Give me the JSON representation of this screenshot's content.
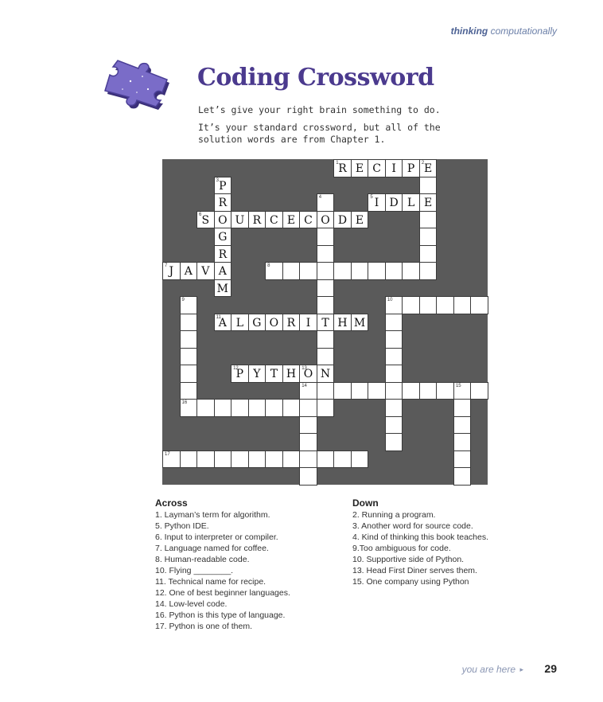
{
  "header": {
    "section_strong": "thinking",
    "section_rest": "computationally"
  },
  "title": "Coding Crossword",
  "intro": {
    "line1": "Let’s give your right brain something to do.",
    "line2": "It’s your standard crossword, but all of the",
    "line3": "solution words are from Chapter 1."
  },
  "across_heading": "Across",
  "down_heading": "Down",
  "across_clues": [
    "1. Layman’s term for algorithm.",
    "5. Python IDE.",
    "6. Input to interpreter or compiler.",
    "7. Language named for coffee.",
    "8. Human-readable code.",
    "10. Flying ________.",
    "11. Technical name for recipe.",
    "12. One of best beginner languages.",
    "14. Low-level code.",
    "16. Python is this type of language.",
    "17. Python is one of them."
  ],
  "down_clues": [
    "2. Running a program.",
    "3. Another word for source code.",
    "4. Kind of thinking this book teaches.",
    "9.Too ambiguous for code.",
    "10. Supportive side of Python.",
    "13. Head First Diner serves them.",
    "15. One company using Python"
  ],
  "footer": {
    "you_are_here": "you are here",
    "page": "29"
  },
  "crossword": {
    "rows": 19,
    "cols": 19,
    "cells": [
      [
        0,
        10,
        "R",
        "1"
      ],
      [
        0,
        11,
        "E",
        ""
      ],
      [
        0,
        12,
        "C",
        ""
      ],
      [
        0,
        13,
        "I",
        ""
      ],
      [
        0,
        14,
        "P",
        ""
      ],
      [
        0,
        15,
        "E",
        "2"
      ],
      [
        1,
        3,
        "P",
        "3"
      ],
      [
        1,
        15,
        "",
        ""
      ],
      [
        2,
        3,
        "R",
        ""
      ],
      [
        2,
        9,
        "",
        "4"
      ],
      [
        2,
        12,
        "I",
        "5"
      ],
      [
        2,
        13,
        "D",
        ""
      ],
      [
        2,
        14,
        "L",
        ""
      ],
      [
        2,
        15,
        "E",
        ""
      ],
      [
        3,
        2,
        "S",
        "6"
      ],
      [
        3,
        3,
        "O",
        ""
      ],
      [
        3,
        4,
        "U",
        ""
      ],
      [
        3,
        5,
        "R",
        ""
      ],
      [
        3,
        6,
        "C",
        ""
      ],
      [
        3,
        7,
        "E",
        ""
      ],
      [
        3,
        8,
        "C",
        ""
      ],
      [
        3,
        9,
        "O",
        ""
      ],
      [
        3,
        10,
        "D",
        ""
      ],
      [
        3,
        11,
        "E",
        ""
      ],
      [
        3,
        15,
        "",
        ""
      ],
      [
        4,
        3,
        "G",
        ""
      ],
      [
        4,
        9,
        "",
        ""
      ],
      [
        4,
        15,
        "",
        ""
      ],
      [
        5,
        3,
        "R",
        ""
      ],
      [
        5,
        9,
        "",
        ""
      ],
      [
        5,
        15,
        "",
        ""
      ],
      [
        6,
        0,
        "J",
        "7"
      ],
      [
        6,
        1,
        "A",
        ""
      ],
      [
        6,
        2,
        "V",
        ""
      ],
      [
        6,
        3,
        "A",
        ""
      ],
      [
        6,
        6,
        "",
        "8"
      ],
      [
        6,
        7,
        "",
        ""
      ],
      [
        6,
        8,
        "",
        ""
      ],
      [
        6,
        9,
        "",
        ""
      ],
      [
        6,
        10,
        "",
        ""
      ],
      [
        6,
        11,
        "",
        ""
      ],
      [
        6,
        12,
        "",
        ""
      ],
      [
        6,
        13,
        "",
        ""
      ],
      [
        6,
        14,
        "",
        ""
      ],
      [
        6,
        15,
        "",
        ""
      ],
      [
        7,
        3,
        "M",
        ""
      ],
      [
        7,
        9,
        "",
        ""
      ],
      [
        8,
        1,
        "",
        "9"
      ],
      [
        8,
        9,
        "",
        ""
      ],
      [
        8,
        13,
        "",
        "10"
      ],
      [
        8,
        14,
        "",
        ""
      ],
      [
        8,
        15,
        "",
        ""
      ],
      [
        8,
        16,
        "",
        ""
      ],
      [
        8,
        17,
        "",
        ""
      ],
      [
        8,
        18,
        "",
        ""
      ],
      [
        9,
        1,
        "",
        ""
      ],
      [
        9,
        3,
        "A",
        "11"
      ],
      [
        9,
        4,
        "L",
        ""
      ],
      [
        9,
        5,
        "G",
        ""
      ],
      [
        9,
        6,
        "O",
        ""
      ],
      [
        9,
        7,
        "R",
        ""
      ],
      [
        9,
        8,
        "I",
        ""
      ],
      [
        9,
        9,
        "T",
        ""
      ],
      [
        9,
        10,
        "H",
        ""
      ],
      [
        9,
        11,
        "M",
        ""
      ],
      [
        9,
        13,
        "",
        ""
      ],
      [
        10,
        1,
        "",
        ""
      ],
      [
        10,
        9,
        "",
        ""
      ],
      [
        10,
        13,
        "",
        ""
      ],
      [
        11,
        1,
        "",
        ""
      ],
      [
        11,
        9,
        "",
        ""
      ],
      [
        11,
        13,
        "",
        ""
      ],
      [
        12,
        1,
        "",
        ""
      ],
      [
        12,
        4,
        "P",
        "12"
      ],
      [
        12,
        5,
        "Y",
        ""
      ],
      [
        12,
        6,
        "T",
        ""
      ],
      [
        12,
        7,
        "H",
        ""
      ],
      [
        12,
        8,
        "O",
        "13"
      ],
      [
        12,
        9,
        "N",
        ""
      ],
      [
        12,
        13,
        "",
        ""
      ],
      [
        13,
        1,
        "",
        ""
      ],
      [
        13,
        8,
        "",
        "14"
      ],
      [
        13,
        9,
        "",
        ""
      ],
      [
        13,
        10,
        "",
        ""
      ],
      [
        13,
        11,
        "",
        ""
      ],
      [
        13,
        12,
        "",
        ""
      ],
      [
        13,
        13,
        "",
        ""
      ],
      [
        13,
        14,
        "",
        ""
      ],
      [
        13,
        15,
        "",
        ""
      ],
      [
        13,
        16,
        "",
        ""
      ],
      [
        13,
        17,
        "",
        "15"
      ],
      [
        13,
        18,
        "",
        ""
      ],
      [
        14,
        1,
        "",
        "16"
      ],
      [
        14,
        2,
        "",
        ""
      ],
      [
        14,
        3,
        "",
        ""
      ],
      [
        14,
        4,
        "",
        ""
      ],
      [
        14,
        5,
        "",
        ""
      ],
      [
        14,
        6,
        "",
        ""
      ],
      [
        14,
        7,
        "",
        ""
      ],
      [
        14,
        8,
        "",
        ""
      ],
      [
        14,
        9,
        "",
        ""
      ],
      [
        14,
        13,
        "",
        ""
      ],
      [
        14,
        17,
        "",
        ""
      ],
      [
        15,
        8,
        "",
        ""
      ],
      [
        15,
        13,
        "",
        ""
      ],
      [
        15,
        17,
        "",
        ""
      ],
      [
        16,
        8,
        "",
        ""
      ],
      [
        16,
        13,
        "",
        ""
      ],
      [
        16,
        17,
        "",
        ""
      ],
      [
        17,
        0,
        "",
        "17"
      ],
      [
        17,
        1,
        "",
        ""
      ],
      [
        17,
        2,
        "",
        ""
      ],
      [
        17,
        3,
        "",
        ""
      ],
      [
        17,
        4,
        "",
        ""
      ],
      [
        17,
        5,
        "",
        ""
      ],
      [
        17,
        6,
        "",
        ""
      ],
      [
        17,
        7,
        "",
        ""
      ],
      [
        17,
        8,
        "",
        ""
      ],
      [
        17,
        9,
        "",
        ""
      ],
      [
        17,
        10,
        "",
        ""
      ],
      [
        17,
        11,
        "",
        ""
      ],
      [
        17,
        17,
        "",
        ""
      ],
      [
        18,
        8,
        "",
        ""
      ],
      [
        18,
        17,
        "",
        ""
      ]
    ]
  },
  "colors": {
    "grid_background": "#5a5a5a",
    "title": "#4b3a8e",
    "puzzle_piece": "#7a6cc8"
  }
}
